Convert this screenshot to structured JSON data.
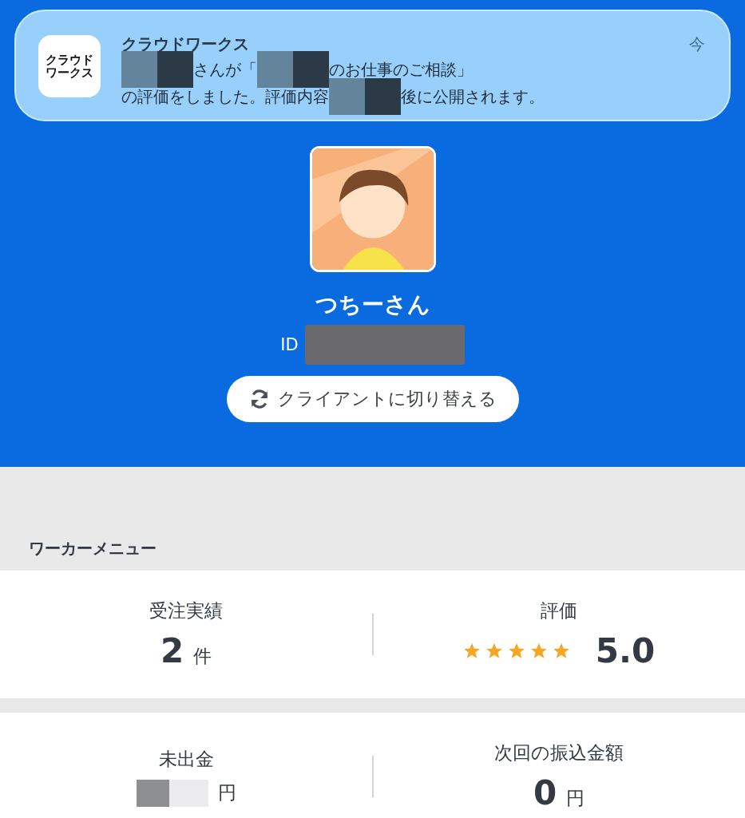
{
  "notification": {
    "icon_text": [
      "クラウド",
      "ワークス"
    ],
    "app": "クラウドワークス",
    "time": "今",
    "lines": [
      [
        {
          "kind": "redacted"
        },
        {
          "kind": "text",
          "text": "さんが「"
        },
        {
          "kind": "redacted"
        },
        {
          "kind": "text",
          "text": "のお仕事のご相談」"
        }
      ],
      [
        {
          "kind": "text",
          "text": "の評価をしました。評価内容"
        },
        {
          "kind": "redacted"
        },
        {
          "kind": "text",
          "text": "後に公開されます。"
        }
      ]
    ]
  },
  "profile": {
    "name": "つちーさん",
    "id_label": "ID",
    "switch_button": "クライアントに切り替える"
  },
  "menu_title": "ワーカーメニュー",
  "cards": [
    {
      "items": [
        {
          "kind": "count",
          "label": "受注実績",
          "value": "2",
          "unit": "件"
        },
        {
          "kind": "rating",
          "label": "評価",
          "stars": 5,
          "value": "5.0"
        }
      ]
    },
    {
      "items": [
        {
          "kind": "redacted",
          "label": "未出金",
          "unit": "円"
        },
        {
          "kind": "count",
          "label": "次回の振込金額",
          "value": "0",
          "unit": "円"
        }
      ]
    }
  ]
}
